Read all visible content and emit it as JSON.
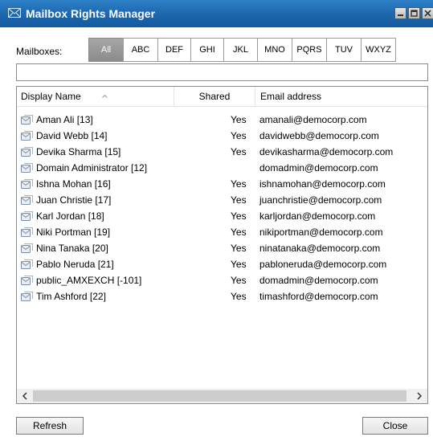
{
  "window": {
    "title": "Mailbox Rights Manager"
  },
  "filter": {
    "label": "Mailboxes:",
    "tabs": [
      {
        "label": "All",
        "active": true
      },
      {
        "label": "ABC",
        "active": false
      },
      {
        "label": "DEF",
        "active": false
      },
      {
        "label": "GHI",
        "active": false
      },
      {
        "label": "JKL",
        "active": false
      },
      {
        "label": "MNO",
        "active": false
      },
      {
        "label": "PQRS",
        "active": false
      },
      {
        "label": "TUV",
        "active": false
      },
      {
        "label": "WXYZ",
        "active": false
      }
    ],
    "search_value": ""
  },
  "list": {
    "columns": {
      "name": "Display Name",
      "shared": "Shared",
      "email": "Email address"
    },
    "sort": {
      "column": "name",
      "direction": "ascending"
    },
    "rows": [
      {
        "name": "Aman Ali [13]",
        "shared": "Yes",
        "email": "amanali@democorp.com"
      },
      {
        "name": "David Webb [14]",
        "shared": "Yes",
        "email": "davidwebb@democorp.com"
      },
      {
        "name": "Devika Sharma [15]",
        "shared": "Yes",
        "email": "devikasharma@democorp.com"
      },
      {
        "name": "Domain Administrator [12]",
        "shared": "",
        "email": "domadmin@democorp.com"
      },
      {
        "name": "Ishna Mohan [16]",
        "shared": "Yes",
        "email": "ishnamohan@democorp.com"
      },
      {
        "name": "Juan Christie [17]",
        "shared": "Yes",
        "email": "juanchristie@democorp.com"
      },
      {
        "name": "Karl Jordan [18]",
        "shared": "Yes",
        "email": "karljordan@democorp.com"
      },
      {
        "name": "Niki Portman [19]",
        "shared": "Yes",
        "email": "nikiportman@democorp.com"
      },
      {
        "name": "Nina Tanaka [20]",
        "shared": "Yes",
        "email": "ninatanaka@democorp.com"
      },
      {
        "name": "Pablo Neruda [21]",
        "shared": "Yes",
        "email": "pabloneruda@democorp.com"
      },
      {
        "name": "public_AMXEXCH [-101]",
        "shared": "Yes",
        "email": "domadmin@democorp.com"
      },
      {
        "name": "Tim Ashford [22]",
        "shared": "Yes",
        "email": "timashford@democorp.com"
      }
    ]
  },
  "buttons": {
    "refresh": "Refresh",
    "close": "Close"
  },
  "icons": {
    "app": "mailbox-envelope-icon",
    "row": "mailbox-icon"
  },
  "colors": {
    "titlebar": "#1c66ad",
    "active_tab": "#999999"
  }
}
